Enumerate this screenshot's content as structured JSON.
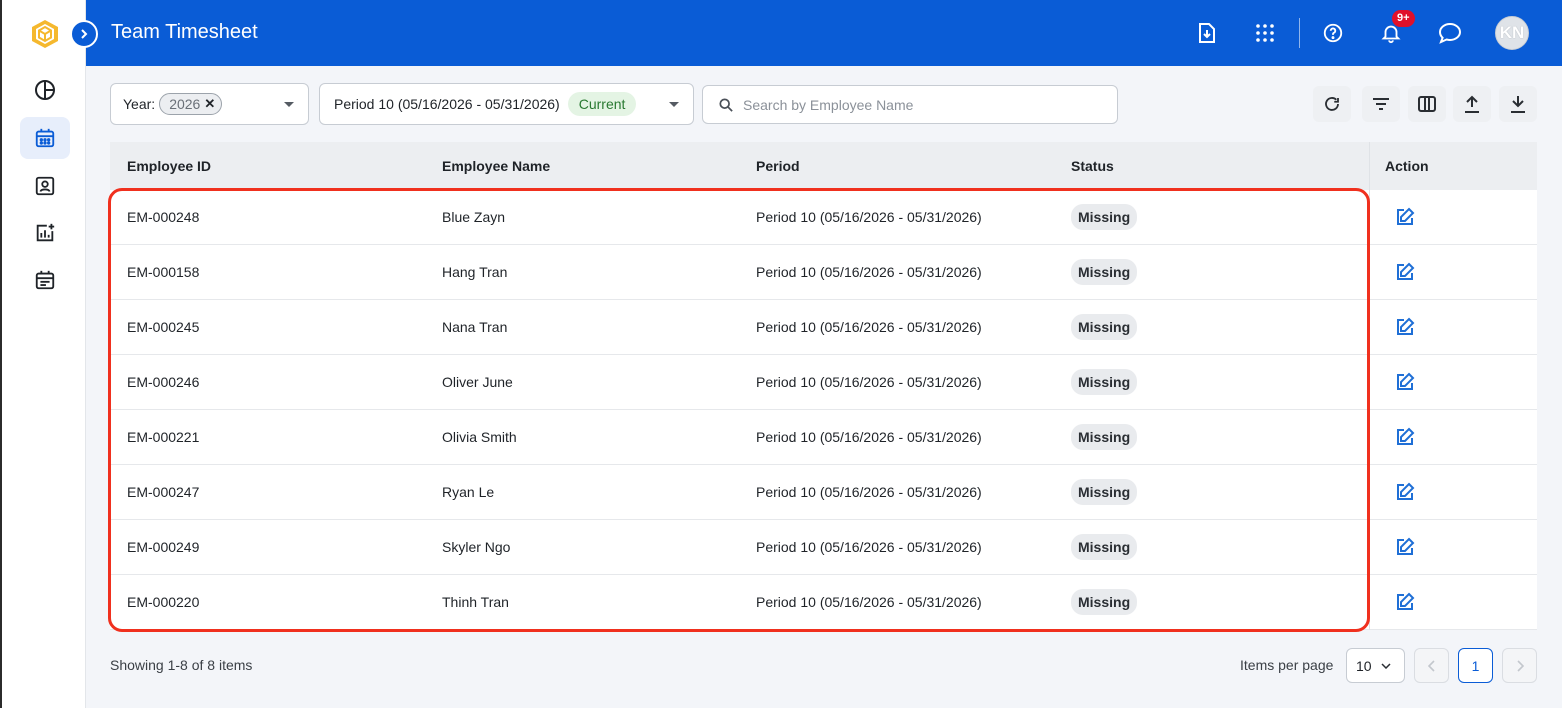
{
  "header": {
    "title": "Team Timesheet",
    "notification_badge": "9+",
    "avatar_initials": "KN",
    "color": "#0a5cd6"
  },
  "sidebar": {
    "items": [
      {
        "icon": "pie-chart-icon",
        "active": false
      },
      {
        "icon": "calendar-icon",
        "active": true
      },
      {
        "icon": "contact-card-icon",
        "active": false
      },
      {
        "icon": "chart-add-icon",
        "active": false
      },
      {
        "icon": "schedule-list-icon",
        "active": false
      }
    ]
  },
  "filters": {
    "year_label": "Year:",
    "year_value": "2026",
    "period_value": "Period 10 (05/16/2026 - 05/31/2026)",
    "period_tag": "Current",
    "search_placeholder": "Search by Employee Name"
  },
  "table": {
    "columns": [
      "Employee ID",
      "Employee Name",
      "Period",
      "Status",
      "Action"
    ],
    "rows": [
      {
        "id": "EM-000248",
        "name": "Blue Zayn",
        "period": "Period 10 (05/16/2026 - 05/31/2026)",
        "status": "Missing"
      },
      {
        "id": "EM-000158",
        "name": "Hang Tran",
        "period": "Period 10 (05/16/2026 - 05/31/2026)",
        "status": "Missing"
      },
      {
        "id": "EM-000245",
        "name": "Nana Tran",
        "period": "Period 10 (05/16/2026 - 05/31/2026)",
        "status": "Missing"
      },
      {
        "id": "EM-000246",
        "name": "Oliver June",
        "period": "Period 10 (05/16/2026 - 05/31/2026)",
        "status": "Missing"
      },
      {
        "id": "EM-000221",
        "name": "Olivia Smith",
        "period": "Period 10 (05/16/2026 - 05/31/2026)",
        "status": "Missing"
      },
      {
        "id": "EM-000247",
        "name": "Ryan Le",
        "period": "Period 10 (05/16/2026 - 05/31/2026)",
        "status": "Missing"
      },
      {
        "id": "EM-000249",
        "name": "Skyler Ngo",
        "period": "Period 10 (05/16/2026 - 05/31/2026)",
        "status": "Missing"
      },
      {
        "id": "EM-000220",
        "name": "Thinh Tran",
        "period": "Period 10 (05/16/2026 - 05/31/2026)",
        "status": "Missing"
      }
    ]
  },
  "footer": {
    "showing": "Showing 1-8 of 8 items",
    "items_per_page_label": "Items per page",
    "items_per_page": "10",
    "current_page": "1"
  }
}
